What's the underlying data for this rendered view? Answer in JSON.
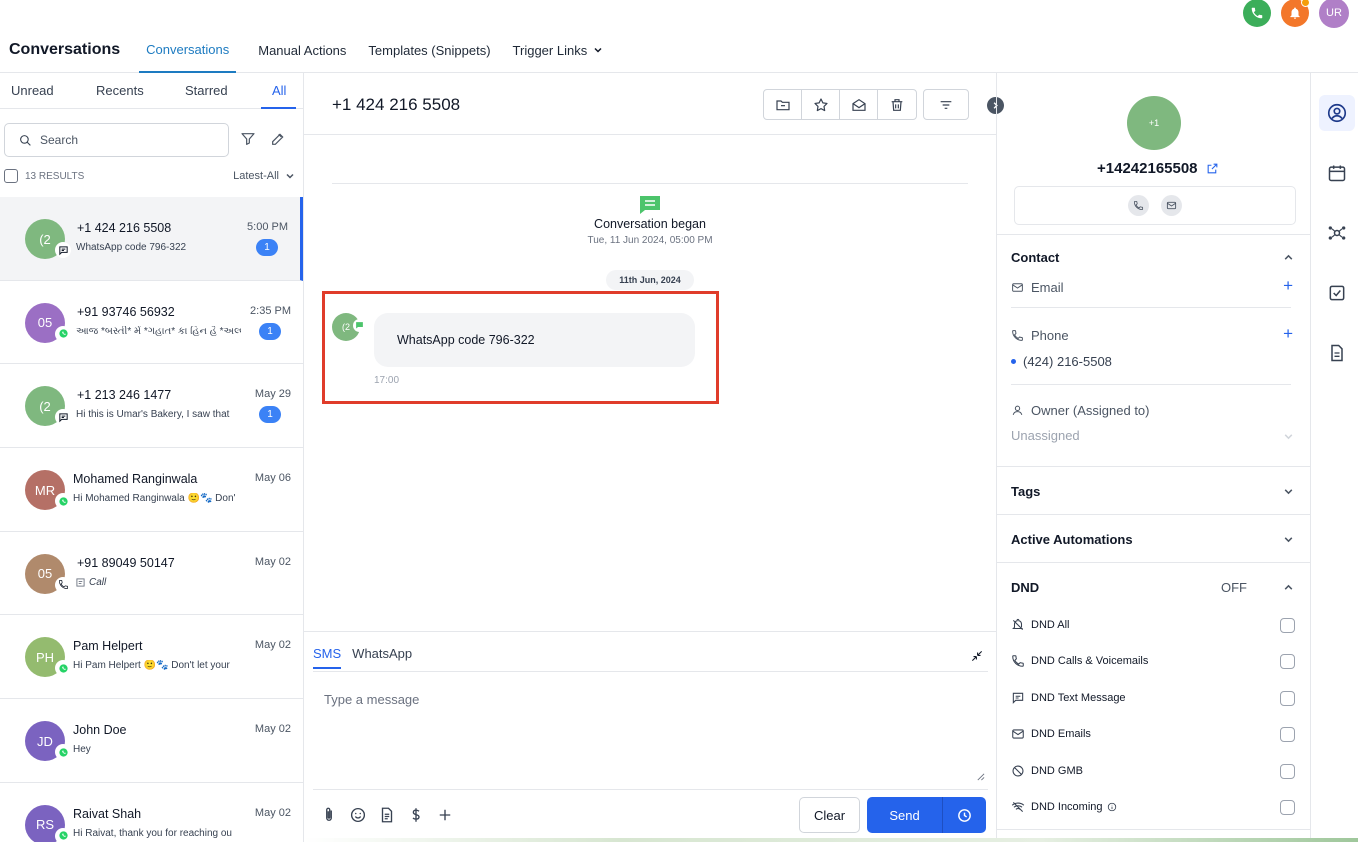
{
  "global": {
    "avatar_initials": "UR",
    "call_icon": "phone-icon",
    "bell_icon": "bell-icon"
  },
  "nav": {
    "app_title": "Conversations",
    "tabs": [
      {
        "label": "Conversations",
        "active": true
      },
      {
        "label": "Manual Actions"
      },
      {
        "label": "Templates (Snippets)"
      },
      {
        "label": "Trigger Links"
      }
    ]
  },
  "left": {
    "tabs": [
      "Unread",
      "Recents",
      "Starred",
      "All"
    ],
    "active_tab": "All",
    "search_placeholder": "Search",
    "results_count": "13 RESULTS",
    "sort_label": "Latest-All",
    "conversations": [
      {
        "initials": "(2",
        "name": "+1 424 216 5508",
        "preview": "WhatsApp code 796-322",
        "time": "5:00 PM",
        "unread": "1",
        "channel": "sms",
        "color": "#7fb87f"
      },
      {
        "initials": "05",
        "name": "+91 93746 56932",
        "preview": "આજ *બસ્તી* મેં *ગહાત* કા હિન હૈ *અલ્લ...",
        "time": "2:35 PM",
        "unread": "1",
        "channel": "whatsapp",
        "color": "#9b6fc4"
      },
      {
        "initials": "(2",
        "name": "+1 213 246 1477",
        "preview": "Hi this is Umar's Bakery, I saw that",
        "time": "May 29",
        "unread": "1",
        "channel": "sms",
        "color": "#7fb87f"
      },
      {
        "initials": "MR",
        "name": "Mohamed Ranginwala",
        "preview": "Hi Mohamed Ranginwala 🙂🐾 Don'",
        "time": "May 06",
        "unread": "",
        "channel": "whatsapp",
        "color": "#b57066"
      },
      {
        "initials": "05",
        "name": "+91 89049 50147",
        "preview": "Call",
        "time": "May 02",
        "unread": "",
        "channel": "call",
        "color": "#b08a6c"
      },
      {
        "initials": "PH",
        "name": "Pam Helpert",
        "preview": "Hi Pam Helpert 🙂🐾 Don't let your",
        "time": "May 02",
        "unread": "",
        "channel": "whatsapp",
        "color": "#94bb6f"
      },
      {
        "initials": "JD",
        "name": "John Doe",
        "preview": "Hey",
        "time": "May 02",
        "unread": "",
        "channel": "whatsapp",
        "color": "#7b63c0"
      },
      {
        "initials": "RS",
        "name": "Raivat Shah",
        "preview": "Hi Raivat, thank you for reaching ou",
        "time": "May 02",
        "unread": "",
        "channel": "whatsapp",
        "color": "#7b63c0"
      }
    ]
  },
  "center": {
    "phone": "+1 424 216 5508",
    "began_title": "Conversation began",
    "began_date": "Tue, 11 Jun 2024, 05:00 PM",
    "day_chip": "11th Jun, 2024",
    "message": {
      "avatar": "(2",
      "text": "WhatsApp code 796-322",
      "time": "17:00"
    },
    "composer": {
      "tabs": [
        "SMS",
        "WhatsApp"
      ],
      "active_tab": "SMS",
      "placeholder": "Type a message",
      "clear_label": "Clear",
      "send_label": "Send"
    }
  },
  "right": {
    "avatar": "+1",
    "phone": "+14242165508",
    "contact_section": "Contact",
    "email_label": "Email",
    "phone_label": "Phone",
    "phone_value": "(424) 216-5508",
    "owner_label": "Owner (Assigned to)",
    "owner_value": "Unassigned",
    "tags_section": "Tags",
    "automations_section": "Active Automations",
    "dnd_section": "DND",
    "dnd_status": "OFF",
    "dnd_items": [
      "DND All",
      "DND Calls & Voicemails",
      "DND Text Message",
      "DND Emails",
      "DND GMB",
      "DND Incoming"
    ]
  },
  "colors": {
    "accent": "#2563eb",
    "highlight": "#e03c2a"
  }
}
